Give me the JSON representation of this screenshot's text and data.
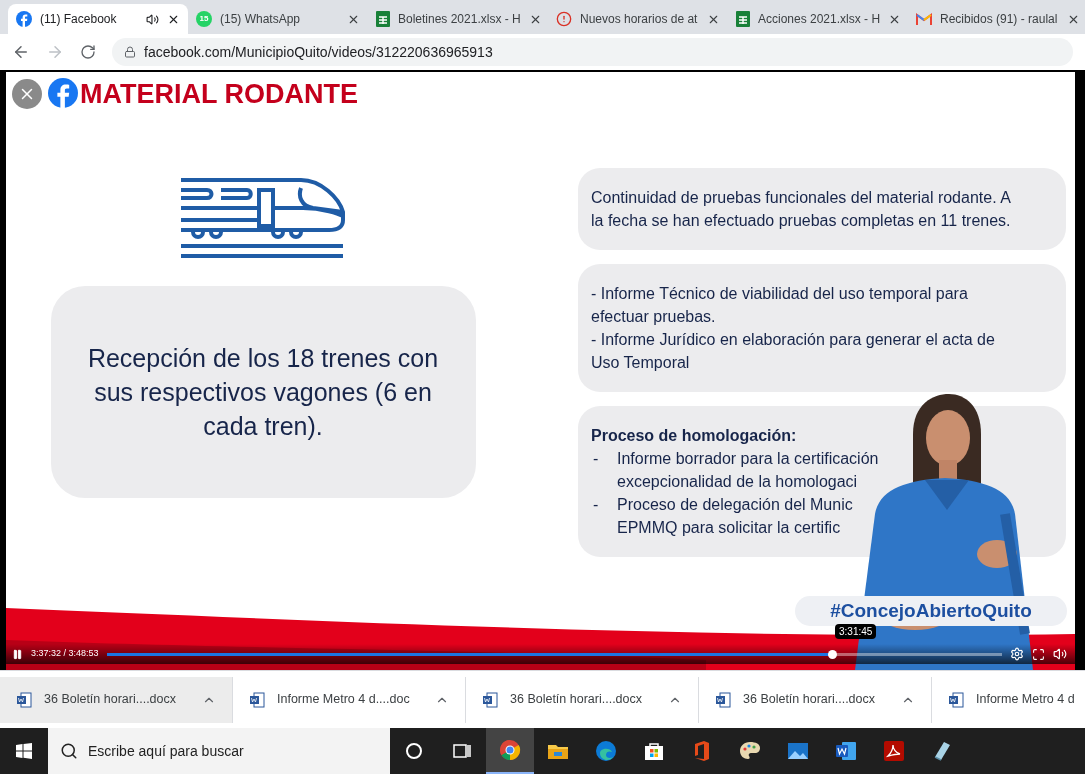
{
  "browser": {
    "tabs": [
      {
        "kind": "facebook",
        "title": "(11) Facebook",
        "audio": true,
        "selected": true
      },
      {
        "kind": "whatsapp",
        "badge": "15",
        "title": "(15) WhatsApp",
        "audio": false,
        "selected": false
      },
      {
        "kind": "sheets",
        "title": "Boletines 2021.xlsx - H",
        "audio": false,
        "selected": false
      },
      {
        "kind": "alert",
        "title": "Nuevos horarios de at",
        "audio": false,
        "selected": false
      },
      {
        "kind": "sheets",
        "title": "Acciones 2021.xlsx - H",
        "audio": false,
        "selected": false
      },
      {
        "kind": "gmail",
        "title": "Recibidos (91) - raulal",
        "audio": false,
        "selected": false
      }
    ],
    "address": "facebook.com/MunicipioQuito/videos/312220636965913"
  },
  "video": {
    "slide": {
      "title": "MATERIAL RODANTE",
      "center_text": "Recepción de los 18 trenes con sus respectivos vagones (6 en cada tren).",
      "boxes": [
        {
          "kind": "paragraph",
          "lines": [
            "Continuidad de pruebas funcionales del material rodante. A",
            "la fecha se han efectuado pruebas completas en 11 trenes."
          ]
        },
        {
          "kind": "paragraph",
          "lines": [
            "- Informe Técnico de viabilidad del uso temporal para",
            "efectuar pruebas.",
            "- Informe Jurídico en elaboración para generar el acta de",
            "Uso Temporal"
          ]
        },
        {
          "kind": "list",
          "heading": "Proceso de homologación:",
          "items": [
            {
              "bullet": "-",
              "lines": [
                "Informe borrador para la certificación",
                "excepcionalidad de la homologaci"
              ]
            },
            {
              "bullet": "-",
              "lines": [
                "Proceso de delegación del Munic",
                "EPMMQ para solicitar la certific"
              ]
            }
          ]
        }
      ],
      "hashtag": "#ConcejoAbiertoQuito"
    },
    "controls": {
      "playing": true,
      "time": "3:37:32 / 3:48:53",
      "hover_time": "3:31:45",
      "level": 0.81
    }
  },
  "downloads": [
    {
      "name": "36 Boletín horari....docx"
    },
    {
      "name": "Informe Metro 4 d....doc"
    },
    {
      "name": "36 Boletín horari....docx"
    },
    {
      "name": "36 Boletín horari....docx"
    },
    {
      "name": "Informe Metro 4 d"
    }
  ],
  "taskbar": {
    "search_placeholder": "Escribe aquí para buscar",
    "apps": [
      {
        "kind": "cortana",
        "selected": false
      },
      {
        "kind": "taskview",
        "selected": false
      },
      {
        "kind": "chrome",
        "selected": true
      },
      {
        "kind": "explorer",
        "selected": false
      },
      {
        "kind": "edge",
        "selected": false
      },
      {
        "kind": "store",
        "selected": false
      },
      {
        "kind": "office",
        "selected": false
      },
      {
        "kind": "paint",
        "selected": false
      },
      {
        "kind": "photos",
        "selected": false
      },
      {
        "kind": "word",
        "selected": false
      },
      {
        "kind": "acrobat",
        "selected": false
      },
      {
        "kind": "notepad",
        "selected": false
      }
    ]
  }
}
